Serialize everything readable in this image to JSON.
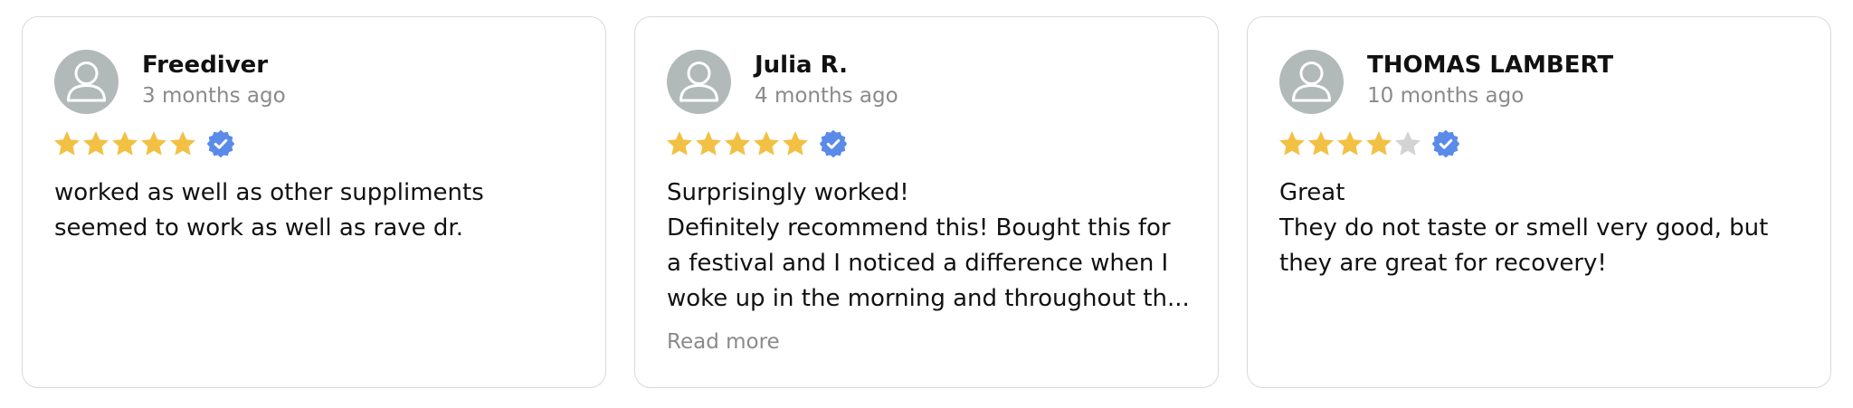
{
  "colors": {
    "star_filled": "#F2C144",
    "star_empty": "#D3D3D3",
    "verified_badge": "#5A8BE8",
    "avatar_bg": "#B2B9B9",
    "card_border": "#D9D9D9",
    "muted_text": "#8A8A8A"
  },
  "reviews": [
    {
      "author": "Freediver",
      "date": "3 months ago",
      "rating": 5,
      "max_rating": 5,
      "verified": true,
      "avatar_icon": "user-silhouette-icon",
      "lines": [
        "worked as well as other suppliments",
        "seemed to work as well as rave dr."
      ]
    },
    {
      "author": "Julia R.",
      "date": "4 months ago",
      "rating": 5,
      "max_rating": 5,
      "verified": true,
      "avatar_icon": "user-silhouette-icon",
      "lines": [
        "Surprisingly worked!",
        "Definitely recommend this! Bought this for",
        "a festival and I noticed a difference when I",
        "woke up in the morning and throughout th..."
      ],
      "read_more": "Read more"
    },
    {
      "author": "THOMAS LAMBERT",
      "date": "10 months ago",
      "rating": 4,
      "max_rating": 5,
      "verified": true,
      "avatar_icon": "user-silhouette-icon",
      "lines": [
        "Great",
        "They do not taste or smell very good, but",
        "they are great for recovery!"
      ]
    }
  ]
}
